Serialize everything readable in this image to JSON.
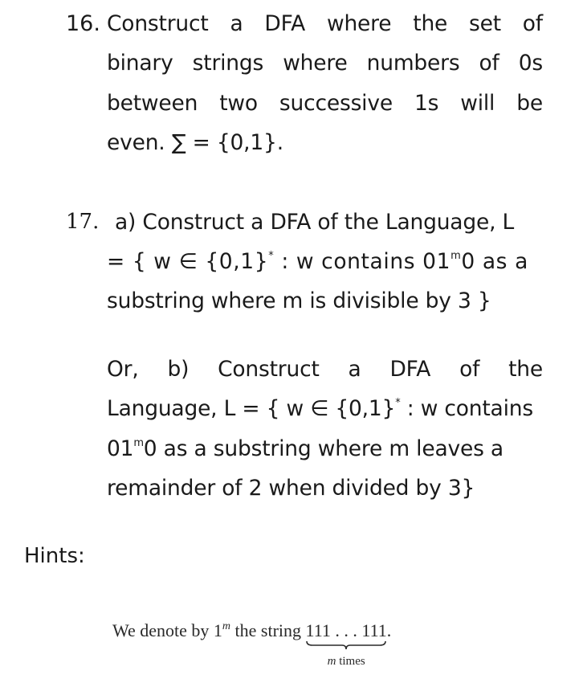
{
  "questions": [
    {
      "number": "16.",
      "lines": [
        [
          "Construct",
          "a",
          "DFA",
          "where",
          "the",
          "set",
          "of"
        ],
        [
          "binary",
          "strings",
          "where",
          "numbers",
          "of",
          "0s"
        ],
        [
          "between",
          "two",
          "successive",
          "1s",
          "will",
          "be"
        ]
      ],
      "last_line": "even. ∑ = {0,1}."
    },
    {
      "number": "17.",
      "part_a": {
        "line1": "a) Construct a DFA of the Language, L",
        "line2_pre": "= { w ∈ {0,1}",
        "line2_sup": "*",
        "line2_mid": " : w contains 01",
        "line2_sup2": "m",
        "line2_post": "0 as a",
        "line3": "substring where m is divisible by 3 }"
      },
      "part_b": {
        "line1_words": [
          "Or,",
          "b)",
          "Construct",
          "a",
          "DFA",
          "of",
          "the"
        ],
        "line2_pre": "Language, L = { w ∈ {0,1}",
        "line2_sup": "*",
        "line2_post": " : w contains",
        "line3_pre": "01",
        "line3_sup": "m",
        "line3_post": "0 as a substring where m leaves a",
        "line4": "remainder of 2 when divided by 3}"
      }
    }
  ],
  "hints": {
    "label": "Hints:",
    "math": {
      "prefix": "We denote by 1",
      "sup": "m",
      "middle": " the string ",
      "braced": "111 . . . 111",
      "suffix": ".",
      "under_var": "m",
      "under_text": " times"
    }
  }
}
